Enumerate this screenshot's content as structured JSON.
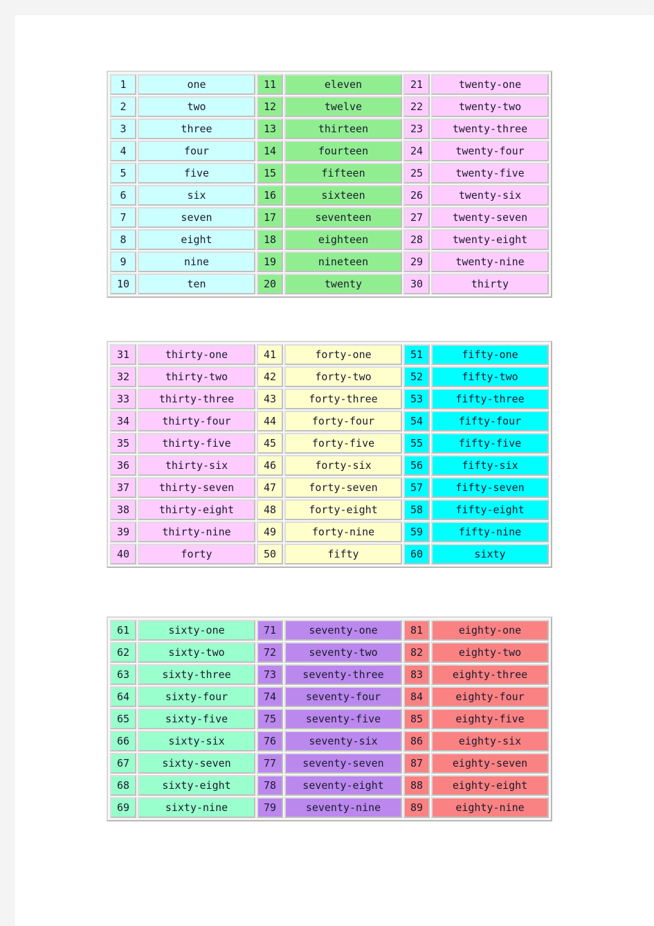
{
  "page": {
    "background": "#ffffff",
    "chrome_color": "#f4f4f4",
    "text_color": "#1a1a2e",
    "border_light": "#dcdcdc",
    "border_dark": "#c0c0c0"
  },
  "tables": [
    {
      "id": "table-1",
      "name": "numbers-1-to-30",
      "columns": [
        {
          "name": "column-1-to-10",
          "fill": "#ccffff",
          "rows": [
            {
              "number": "1",
              "word": "one"
            },
            {
              "number": "2",
              "word": "two"
            },
            {
              "number": "3",
              "word": "three"
            },
            {
              "number": "4",
              "word": "four"
            },
            {
              "number": "5",
              "word": "five"
            },
            {
              "number": "6",
              "word": "six"
            },
            {
              "number": "7",
              "word": "seven"
            },
            {
              "number": "8",
              "word": "eight"
            },
            {
              "number": "9",
              "word": "nine"
            },
            {
              "number": "10",
              "word": "ten"
            }
          ]
        },
        {
          "name": "column-11-to-20",
          "fill": "#90ee90",
          "rows": [
            {
              "number": "11",
              "word": "eleven"
            },
            {
              "number": "12",
              "word": "twelve"
            },
            {
              "number": "13",
              "word": "thirteen"
            },
            {
              "number": "14",
              "word": "fourteen"
            },
            {
              "number": "15",
              "word": "fifteen"
            },
            {
              "number": "16",
              "word": "sixteen"
            },
            {
              "number": "17",
              "word": "seventeen"
            },
            {
              "number": "18",
              "word": "eighteen"
            },
            {
              "number": "19",
              "word": "nineteen"
            },
            {
              "number": "20",
              "word": "twenty"
            }
          ]
        },
        {
          "name": "column-21-to-30",
          "fill": "#ffccff",
          "rows": [
            {
              "number": "21",
              "word": "twenty-one"
            },
            {
              "number": "22",
              "word": "twenty-two"
            },
            {
              "number": "23",
              "word": "twenty-three"
            },
            {
              "number": "24",
              "word": "twenty-four"
            },
            {
              "number": "25",
              "word": "twenty-five"
            },
            {
              "number": "26",
              "word": "twenty-six"
            },
            {
              "number": "27",
              "word": "twenty-seven"
            },
            {
              "number": "28",
              "word": "twenty-eight"
            },
            {
              "number": "29",
              "word": "twenty-nine"
            },
            {
              "number": "30",
              "word": "thirty"
            }
          ]
        }
      ]
    },
    {
      "id": "table-2",
      "name": "numbers-31-to-60",
      "columns": [
        {
          "name": "column-31-to-40",
          "fill": "#ffccff",
          "rows": [
            {
              "number": "31",
              "word": "thirty-one"
            },
            {
              "number": "32",
              "word": "thirty-two"
            },
            {
              "number": "33",
              "word": "thirty-three"
            },
            {
              "number": "34",
              "word": "thirty-four"
            },
            {
              "number": "35",
              "word": "thirty-five"
            },
            {
              "number": "36",
              "word": "thirty-six"
            },
            {
              "number": "37",
              "word": "thirty-seven"
            },
            {
              "number": "38",
              "word": "thirty-eight"
            },
            {
              "number": "39",
              "word": "thirty-nine"
            },
            {
              "number": "40",
              "word": "forty"
            }
          ]
        },
        {
          "name": "column-41-to-50",
          "fill": "#ffffcc",
          "rows": [
            {
              "number": "41",
              "word": "forty-one"
            },
            {
              "number": "42",
              "word": "forty-two"
            },
            {
              "number": "43",
              "word": "forty-three"
            },
            {
              "number": "44",
              "word": "forty-four"
            },
            {
              "number": "45",
              "word": "forty-five"
            },
            {
              "number": "46",
              "word": "forty-six"
            },
            {
              "number": "47",
              "word": "forty-seven"
            },
            {
              "number": "48",
              "word": "forty-eight"
            },
            {
              "number": "49",
              "word": "forty-nine"
            },
            {
              "number": "50",
              "word": "fifty"
            }
          ]
        },
        {
          "name": "column-51-to-60",
          "fill": "#00ffff",
          "rows": [
            {
              "number": "51",
              "word": "fifty-one"
            },
            {
              "number": "52",
              "word": "fifty-two"
            },
            {
              "number": "53",
              "word": "fifty-three"
            },
            {
              "number": "54",
              "word": "fifty-four"
            },
            {
              "number": "55",
              "word": "fifty-five"
            },
            {
              "number": "56",
              "word": "fifty-six"
            },
            {
              "number": "57",
              "word": "fifty-seven"
            },
            {
              "number": "58",
              "word": "fifty-eight"
            },
            {
              "number": "59",
              "word": "fifty-nine"
            },
            {
              "number": "60",
              "word": "sixty"
            }
          ]
        }
      ]
    },
    {
      "id": "table-3",
      "name": "numbers-61-to-89",
      "columns": [
        {
          "name": "column-61-to-69",
          "fill": "#99ffcc",
          "rows": [
            {
              "number": "61",
              "word": "sixty-one"
            },
            {
              "number": "62",
              "word": "sixty-two"
            },
            {
              "number": "63",
              "word": "sixty-three"
            },
            {
              "number": "64",
              "word": "sixty-four"
            },
            {
              "number": "65",
              "word": "sixty-five"
            },
            {
              "number": "66",
              "word": "sixty-six"
            },
            {
              "number": "67",
              "word": "sixty-seven"
            },
            {
              "number": "68",
              "word": "sixty-eight"
            },
            {
              "number": "69",
              "word": "sixty-nine"
            }
          ]
        },
        {
          "name": "column-71-to-79",
          "fill": "#bb88ee",
          "rows": [
            {
              "number": "71",
              "word": "seventy-one"
            },
            {
              "number": "72",
              "word": "seventy-two"
            },
            {
              "number": "73",
              "word": "seventy-three"
            },
            {
              "number": "74",
              "word": "seventy-four"
            },
            {
              "number": "75",
              "word": "seventy-five"
            },
            {
              "number": "76",
              "word": "seventy-six"
            },
            {
              "number": "77",
              "word": "seventy-seven"
            },
            {
              "number": "78",
              "word": "seventy-eight"
            },
            {
              "number": "79",
              "word": "seventy-nine"
            }
          ]
        },
        {
          "name": "column-81-to-89",
          "fill": "#fa8282",
          "rows": [
            {
              "number": "81",
              "word": "eighty-one"
            },
            {
              "number": "82",
              "word": "eighty-two"
            },
            {
              "number": "83",
              "word": "eighty-three"
            },
            {
              "number": "84",
              "word": "eighty-four"
            },
            {
              "number": "85",
              "word": "eighty-five"
            },
            {
              "number": "86",
              "word": "eighty-six"
            },
            {
              "number": "87",
              "word": "eighty-seven"
            },
            {
              "number": "88",
              "word": "eighty-eight"
            },
            {
              "number": "89",
              "word": "eighty-nine"
            }
          ]
        }
      ]
    }
  ]
}
